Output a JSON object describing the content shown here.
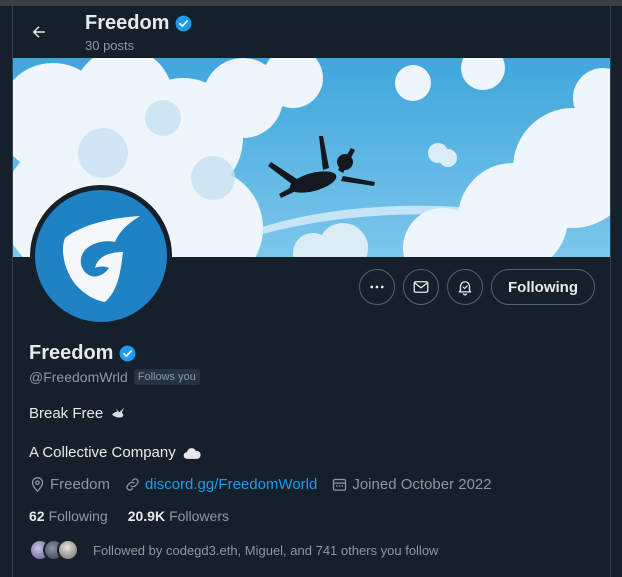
{
  "header": {
    "title": "Freedom",
    "posts_count": "30 posts"
  },
  "profile": {
    "name": "Freedom",
    "handle": "@FreedomWrld",
    "follows_you": "Follows you",
    "bio_line1": "Break Free",
    "bio_line2": "A Collective Company",
    "location": "Freedom",
    "website": "discord.gg/FreedomWorld",
    "joined": "Joined October 2022",
    "following_count": "62",
    "following_label": "Following",
    "followers_count": "20.9K",
    "followers_label": "Followers",
    "followed_by": "Followed by codegd3.eth, Miguel, and 741 others you follow"
  },
  "actions": {
    "following_button": "Following"
  },
  "icons": {
    "back": "arrow-left-icon",
    "verified": "verified-badge-icon",
    "more": "more-horizontal-icon",
    "message": "envelope-icon",
    "notify": "bell-icon",
    "location": "location-pin-icon",
    "link": "link-icon",
    "calendar": "calendar-icon"
  },
  "colors": {
    "background": "#15202b",
    "accent": "#1d9bf0",
    "avatar_bg": "#1e82c4",
    "text": "#e7e9ea",
    "muted": "#8b98a5"
  }
}
